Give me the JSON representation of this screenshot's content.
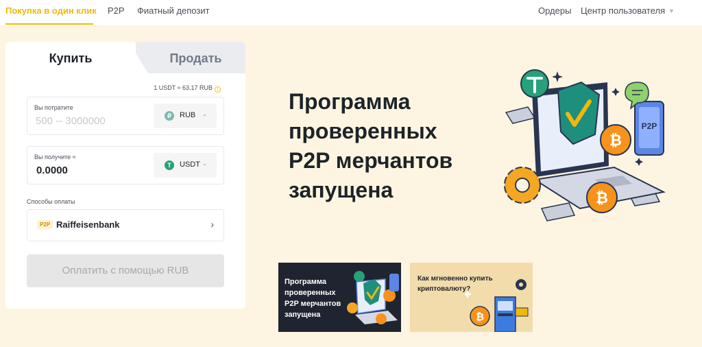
{
  "topnav": {
    "items": [
      "Покупка в один клик",
      "P2P",
      "Фиатный депозит"
    ],
    "orders": "Ордеры",
    "user_center": "Центр пользователя"
  },
  "trade": {
    "tab_buy": "Купить",
    "tab_sell": "Продать",
    "rate": "1 USDT ≈ 63.17 RUB",
    "spend": {
      "label": "Вы потратите",
      "placeholder": "500 -- 3000000",
      "currency": "RUB"
    },
    "receive": {
      "label": "Вы получите ≈",
      "value": "0.0000",
      "currency": "USDT"
    },
    "payment_methods_label": "Способы оплаты",
    "payment_method": {
      "badge": "P2P",
      "name": "Raiffeisenbank"
    },
    "pay_button": "Оплатить с помощью RUB"
  },
  "hero": {
    "title_lines": [
      "Программа",
      "проверенных",
      "P2P мерчантов",
      "запущена"
    ]
  },
  "banners": [
    {
      "lines": [
        "Программа",
        "проверенных",
        "P2P мерчантов",
        "запущена"
      ]
    },
    {
      "lines": [
        "Как мгновенно купить",
        "криптовалюту?"
      ]
    }
  ],
  "colors": {
    "accent": "#f0b90b",
    "page_bg": "#fdf5e1",
    "usdt": "#26a17b",
    "bitcoin": "#f7931a",
    "teal": "#1f8f7d",
    "navy": "#2a3550"
  }
}
